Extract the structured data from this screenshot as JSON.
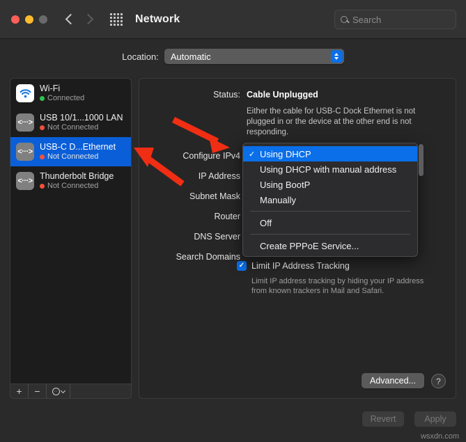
{
  "window": {
    "title": "Network",
    "traffic_lights": [
      "close",
      "minimize",
      "maximize"
    ],
    "nav_back_icon": "chevron-left-icon",
    "nav_forward_icon": "chevron-right-icon",
    "grid_icon": "grid-apps-icon"
  },
  "search": {
    "placeholder": "Search",
    "icon": "search-icon"
  },
  "location": {
    "label": "Location:",
    "selected": "Automatic",
    "options": [
      "Automatic"
    ]
  },
  "sidebar": {
    "items": [
      {
        "name": "Wi-Fi",
        "status": "Connected",
        "status_color": "#30c14e",
        "icon": "wifi-icon",
        "selected": false
      },
      {
        "name": "USB 10/1...1000 LAN",
        "status": "Not Connected",
        "status_color": "#f4503c",
        "icon": "ethernet-icon",
        "selected": false
      },
      {
        "name": "USB-C D...Ethernet",
        "status": "Not Connected",
        "status_color": "#f4503c",
        "icon": "ethernet-icon",
        "selected": true
      },
      {
        "name": "Thunderbolt Bridge",
        "status": "Not Connected",
        "status_color": "#f4503c",
        "icon": "ethernet-icon",
        "selected": false
      }
    ],
    "toolbar": {
      "add": "+",
      "remove": "−",
      "action_icon": "gear-icon",
      "action_chevron": "chevron-down-icon"
    }
  },
  "panel": {
    "status_label": "Status:",
    "status_value": "Cable Unplugged",
    "status_description": "Either the cable for USB-C Dock Ethernet is not plugged in or the device at the other end is not responding.",
    "fields": [
      {
        "label": "Configure IPv4"
      },
      {
        "label": "IP Address"
      },
      {
        "label": "Subnet Mask"
      },
      {
        "label": "Router"
      },
      {
        "label": "DNS Server"
      },
      {
        "label": "Search Domains"
      }
    ],
    "limit_tracking": {
      "label": "Limit IP Address Tracking",
      "checked": true,
      "description": "Limit IP address tracking by hiding your IP address from known trackers in Mail and Safari."
    },
    "advanced_button": "Advanced...",
    "help_button": "?"
  },
  "dropdown": {
    "open": true,
    "items": [
      {
        "label": "Using DHCP",
        "checked": true,
        "separator_after": false
      },
      {
        "label": "Using DHCP with manual address",
        "checked": false,
        "separator_after": false
      },
      {
        "label": "Using BootP",
        "checked": false,
        "separator_after": false
      },
      {
        "label": "Manually",
        "checked": false,
        "separator_after": true
      },
      {
        "label": "Off",
        "checked": false,
        "separator_after": true
      },
      {
        "label": "Create PPPoE Service...",
        "checked": false,
        "separator_after": false
      }
    ],
    "checkmark": "✓"
  },
  "footer": {
    "revert": "Revert",
    "apply": "Apply"
  },
  "watermark": "wsxdn.com",
  "colors": {
    "accent_blue": "#0a6fe8",
    "selection_blue": "#0a5fd8",
    "annotation_red": "#f02e14",
    "connected_green": "#30c14e",
    "disconnected_red": "#f4503c"
  }
}
